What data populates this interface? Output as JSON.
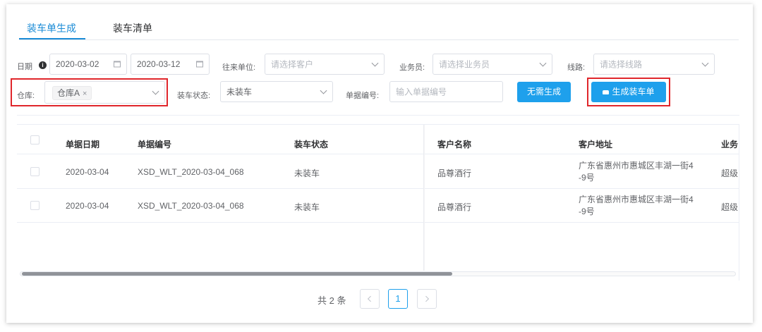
{
  "tabs": [
    "装车单生成",
    "装车清单"
  ],
  "filters": {
    "date_label": "日期",
    "date_start": "2020-03-02",
    "date_end": "2020-03-12",
    "partner_label": "往来单位:",
    "partner_placeholder": "请选择客户",
    "salesman_label": "业务员:",
    "salesman_placeholder": "请选择业务员",
    "route_label": "线路:",
    "route_placeholder": "请选择线路",
    "warehouse_label": "仓库:",
    "warehouse_tag": "仓库A",
    "warehouse_tag_close": "×",
    "load_status_label": "装车状态:",
    "load_status_value": "未装车",
    "doc_no_label": "单据编号:",
    "doc_no_placeholder": "输入单据编号",
    "no_gen_button": "无需生成",
    "gen_button": "生成装车单",
    "gen_button_icon": "car-icon"
  },
  "table": {
    "columns": [
      "单据日期",
      "单据编号",
      "装车状态",
      "客户名称",
      "客户地址",
      "业务"
    ],
    "rows": [
      {
        "date": "2020-03-04",
        "doc_no": "XSD_WLT_2020-03-04_068",
        "status": "未装车",
        "customer": "品尊酒行",
        "address_line1": "广东省惠州市惠城区丰湖一街4",
        "address_line2": "-9号",
        "salesman": "超级"
      },
      {
        "date": "2020-03-04",
        "doc_no": "XSD_WLT_2020-03-04_068",
        "status": "未装车",
        "customer": "品尊酒行",
        "address_line1": "广东省惠州市惠城区丰湖一街4",
        "address_line2": "-9号",
        "salesman": "超级"
      }
    ]
  },
  "pagination": {
    "total_text": "共 2 条",
    "current_page": "1"
  },
  "colors": {
    "accent": "#1ea0ec",
    "highlight": "#e0262b"
  }
}
